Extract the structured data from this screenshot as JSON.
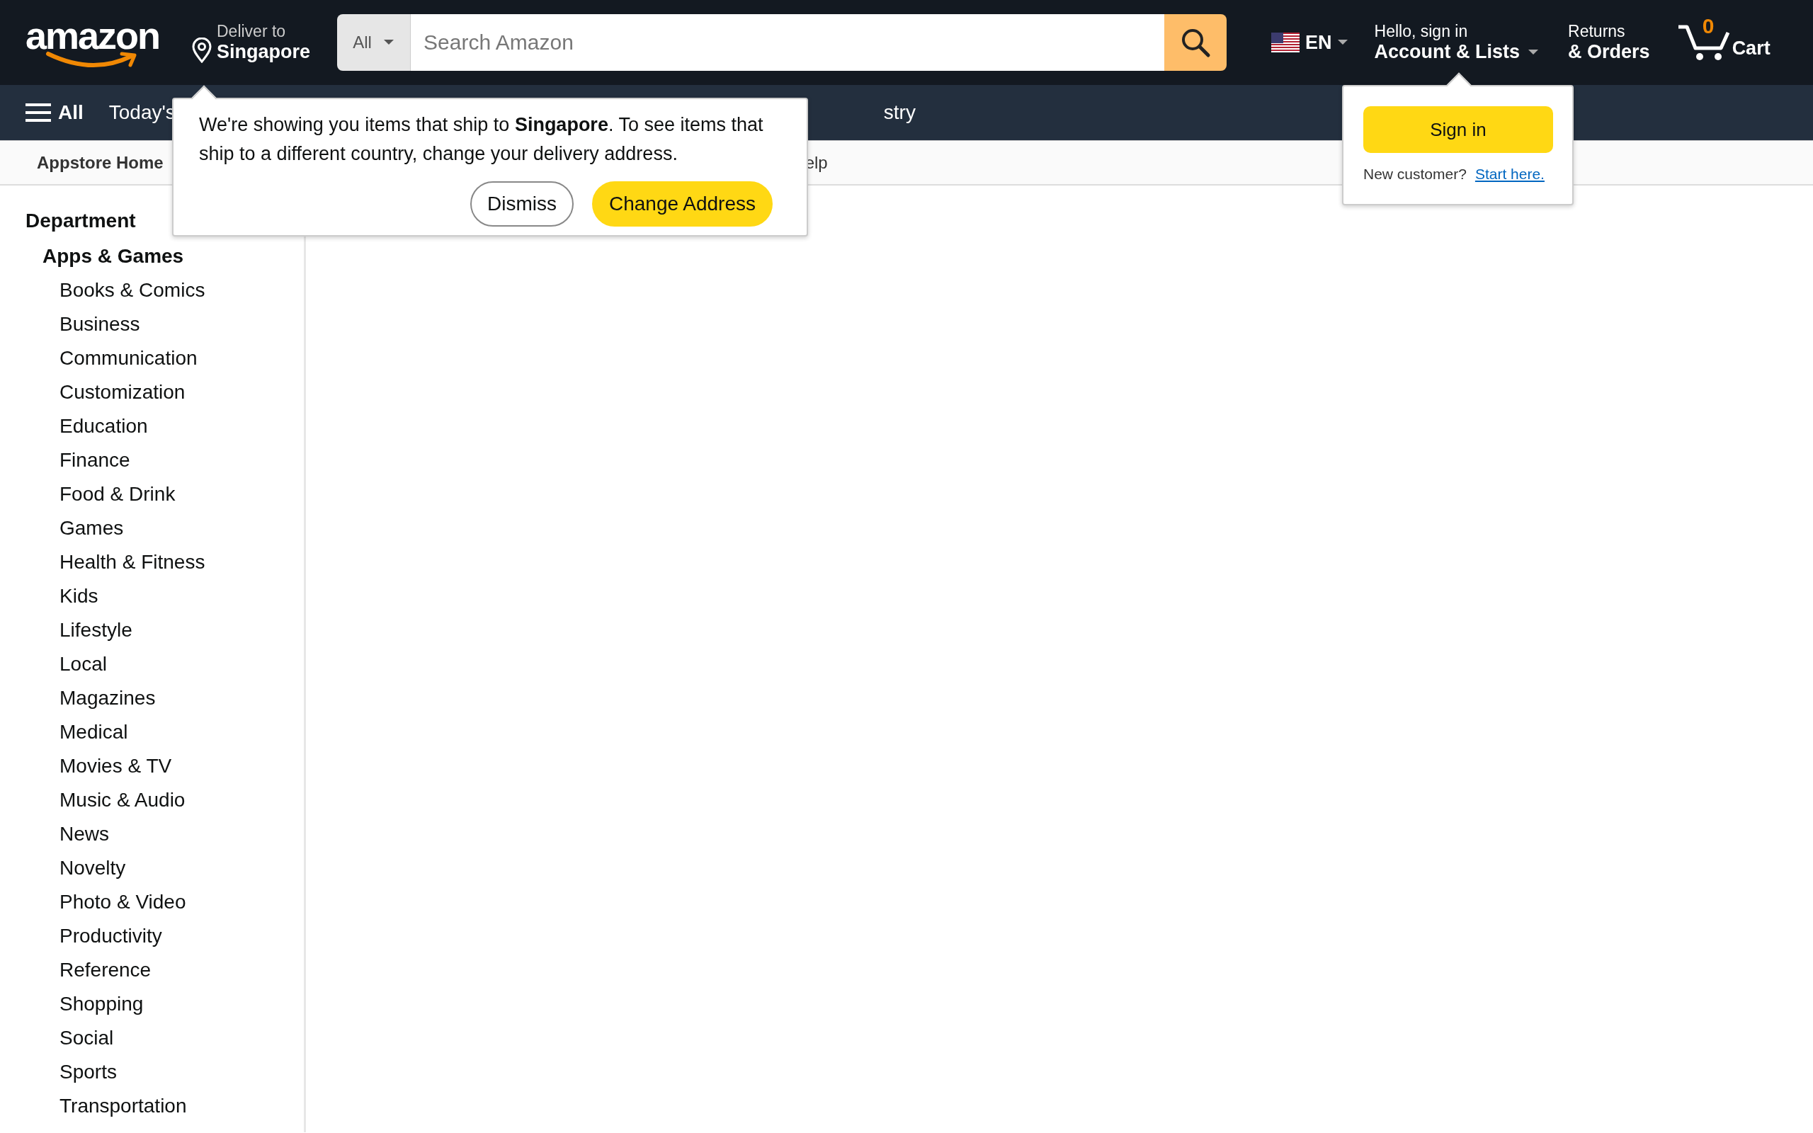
{
  "header": {
    "logo": "amazon",
    "deliver": {
      "label": "Deliver to",
      "location": "Singapore"
    },
    "search": {
      "category": "All",
      "placeholder": "Search Amazon"
    },
    "language": "EN",
    "account": {
      "greeting": "Hello, sign in",
      "label": "Account & Lists"
    },
    "returns": {
      "line1": "Returns",
      "line2": "& Orders"
    },
    "cart": {
      "count": "0",
      "label": "Cart"
    }
  },
  "nav": {
    "menu_label": "All",
    "items": [
      "Today's",
      "stry"
    ]
  },
  "subnav": {
    "items": [
      {
        "label": "Appstore Home",
        "bold": true
      },
      {
        "label": "elp",
        "bold": false
      }
    ]
  },
  "sidebar": {
    "title": "Department",
    "items": [
      {
        "label": "Apps & Games",
        "children": [
          {
            "label": "Books & Comics"
          },
          {
            "label": "Business"
          },
          {
            "label": "Communication"
          },
          {
            "label": "Customization"
          },
          {
            "label": "Education"
          },
          {
            "label": "Finance"
          },
          {
            "label": "Food & Drink"
          },
          {
            "label": "Games"
          },
          {
            "label": "Health & Fitness"
          },
          {
            "label": "Kids"
          },
          {
            "label": "Lifestyle"
          },
          {
            "label": "Local"
          },
          {
            "label": "Magazines"
          },
          {
            "label": "Medical"
          },
          {
            "label": "Movies & TV"
          },
          {
            "label": "Music & Audio"
          },
          {
            "label": "News"
          },
          {
            "label": "Novelty"
          },
          {
            "label": "Photo & Video"
          },
          {
            "label": "Productivity"
          },
          {
            "label": "Reference"
          },
          {
            "label": "Shopping"
          },
          {
            "label": "Social"
          },
          {
            "label": "Sports"
          },
          {
            "label": "Transportation"
          }
        ]
      }
    ]
  },
  "delivery_popover": {
    "message": "We're showing you items that ship to **Singapore**. To see items that ship to a different country, change your delivery address.",
    "buttons": [
      {
        "label": "Dismiss",
        "kind": "secondary"
      },
      {
        "label": "Change Address",
        "kind": "primary"
      }
    ]
  },
  "account_popover": {
    "button": "Sign in",
    "prompt": "New customer?",
    "link": "Start here."
  }
}
